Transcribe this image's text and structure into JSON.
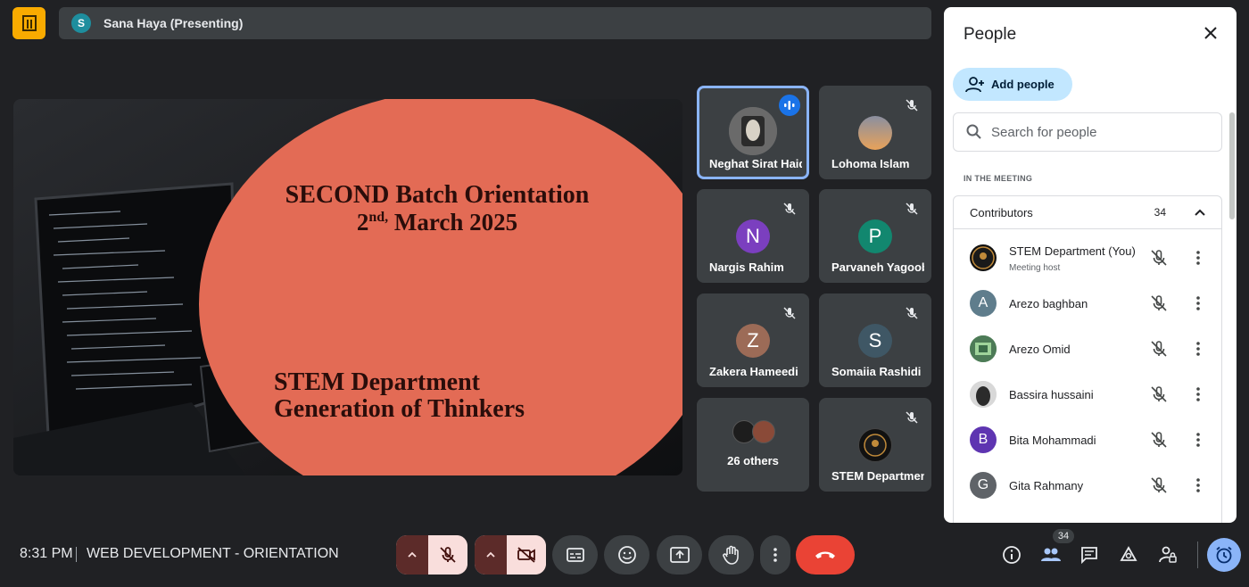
{
  "presenter_bar": {
    "avatar_letter": "S",
    "presenter_label": "Sana Haya (Presenting)"
  },
  "slide": {
    "line1": "SECOND Batch Orientation",
    "line2_day": "2",
    "line2_sup": "nd,",
    "line2_rest": " March 2025",
    "line3": "STEM Department",
    "line4": "Generation of Thinkers"
  },
  "tiles": [
    {
      "name": "Neghat Sirat Haidari",
      "avatar": "",
      "speaking": true
    },
    {
      "name": "Lohoma Islam",
      "avatar": ""
    },
    {
      "name": "Nargis Rahim",
      "avatar": "N"
    },
    {
      "name": "Parvaneh Yagoobi",
      "avatar": "P"
    },
    {
      "name": "Zakera Hameedi",
      "avatar": "Z"
    },
    {
      "name": "Somaiia Rashidi",
      "avatar": "S"
    },
    {
      "name": "26 others",
      "avatar": ""
    },
    {
      "name": "STEM Department",
      "avatar": ""
    }
  ],
  "people_panel": {
    "title": "People",
    "add_people_label": "Add people",
    "search_placeholder": "Search for people",
    "section_label": "IN THE MEETING",
    "group_name": "Contributors",
    "group_count": "34",
    "people": [
      {
        "name": "STEM Department (You)",
        "sub": "Meeting host",
        "avatar": ""
      },
      {
        "name": "Arezo baghban",
        "avatar": "A"
      },
      {
        "name": "Arezo Omid",
        "avatar": ""
      },
      {
        "name": "Bassira hussaini",
        "avatar": ""
      },
      {
        "name": "Bita Mohammadi",
        "avatar": "B"
      },
      {
        "name": "Gita Rahmany",
        "avatar": "G"
      }
    ]
  },
  "bottom_bar": {
    "time": "8:31 PM",
    "meeting_title": "WEB DEVELOPMENT - ORIENTATION",
    "people_count_badge": "34"
  },
  "colors": {
    "background": "#202124",
    "tile": "#3c4043",
    "hangup": "#ea4335",
    "accent": "#8ab4f8",
    "add_people_bg": "#c2e7ff"
  }
}
